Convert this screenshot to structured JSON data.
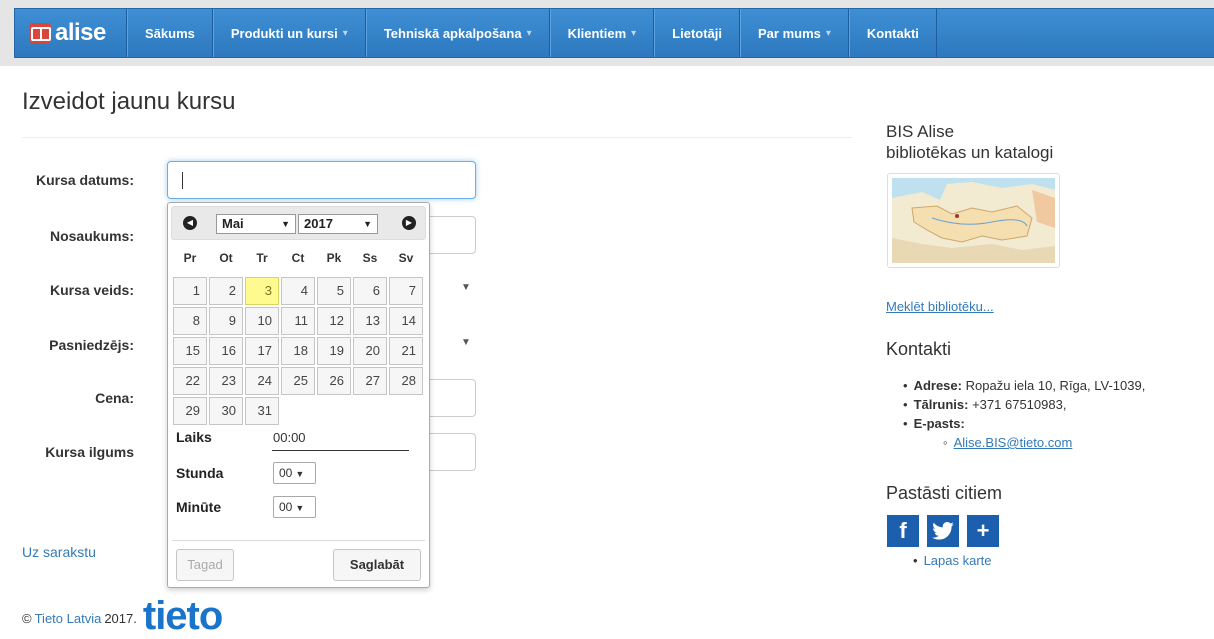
{
  "nav": {
    "brand": "alise",
    "items": [
      {
        "label": "Sākums",
        "dropdown": false
      },
      {
        "label": "Produkti un kursi",
        "dropdown": true
      },
      {
        "label": "Tehniskā apkalpošana",
        "dropdown": true
      },
      {
        "label": "Klientiem",
        "dropdown": true
      },
      {
        "label": "Lietotāji",
        "dropdown": false
      },
      {
        "label": "Par mums",
        "dropdown": true
      },
      {
        "label": "Kontakti",
        "dropdown": false
      }
    ]
  },
  "page": {
    "title": "Izveidot jaunu kursu",
    "fields": {
      "date": "Kursa datums:",
      "name": "Nosaukums:",
      "type": "Kursa veids:",
      "teacher": "Pasniedzējs:",
      "price": "Cena:",
      "duration": "Kursa ilgums"
    },
    "back_link": "Uz sarakstu"
  },
  "datepicker": {
    "month": "Mai",
    "year": "2017",
    "weekdays": [
      "Pr",
      "Ot",
      "Tr",
      "Ct",
      "Pk",
      "Ss",
      "Sv"
    ],
    "days": [
      1,
      2,
      3,
      4,
      5,
      6,
      7,
      8,
      9,
      10,
      11,
      12,
      13,
      14,
      15,
      16,
      17,
      18,
      19,
      20,
      21,
      22,
      23,
      24,
      25,
      26,
      27,
      28,
      29,
      30,
      31
    ],
    "today": 3,
    "time_label": "Laiks",
    "time_value": "00:00",
    "hour_label": "Stunda",
    "hour_value": "00",
    "minute_label": "Minūte",
    "minute_value": "00",
    "now_button": "Tagad",
    "save_button": "Saglabāt"
  },
  "footer": {
    "copyright": "©",
    "company": "Tieto Latvia",
    "year": "2017.",
    "logo": "tieto"
  },
  "sidebar": {
    "title_line1": "BIS Alise",
    "title_line2": "bibliotēkas un katalogi",
    "search_link": "Meklēt bibliotēku...",
    "contacts_heading": "Kontakti",
    "address_label": "Adrese:",
    "address_value": "Ropažu iela 10, Rīga, LV-1039,",
    "phone_label": "Tālrunis:",
    "phone_value": "+371 67510983,",
    "email_label": "E-pasts:",
    "email_value": "Alise.BIS@tieto.com",
    "share_heading": "Pastāsti citiem",
    "sitemap": "Lapas karte"
  },
  "colors": {
    "nav_blue": "#2d78be",
    "link": "#337ab7",
    "today": "#fffa90",
    "share": "#1c5fae"
  }
}
